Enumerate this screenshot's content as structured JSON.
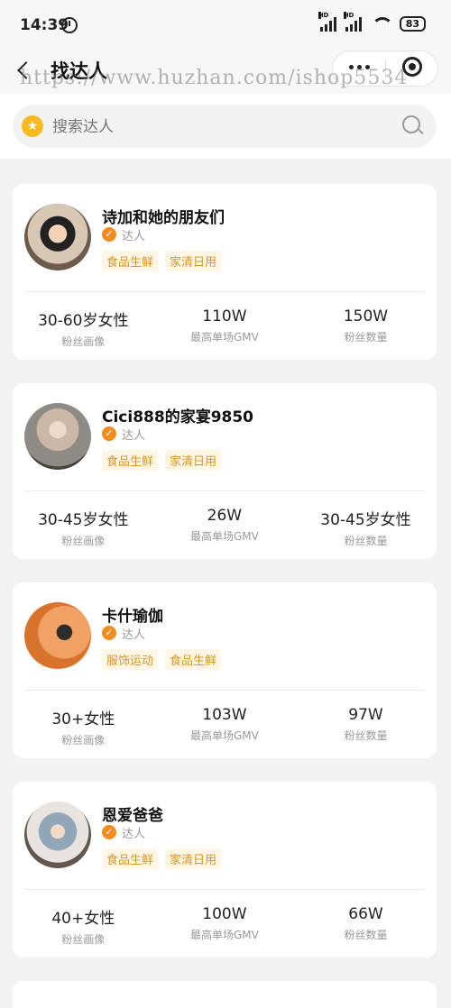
{
  "status": {
    "time": "14:39",
    "battery": "83",
    "signal_label": "HD"
  },
  "nav": {
    "title": "找达人"
  },
  "watermark": "https://www.huzhan.com/ishop5534",
  "search": {
    "placeholder": "搜索达人"
  },
  "influencers": [
    {
      "name": "诗加和她的朋友们",
      "role": "达人",
      "tags": [
        "食品生鲜",
        "家清日用"
      ],
      "stats": [
        {
          "value": "30-60岁女性",
          "label": "粉丝画像"
        },
        {
          "value": "110W",
          "label": "最高单场GMV"
        },
        {
          "value": "150W",
          "label": "粉丝数量"
        }
      ]
    },
    {
      "name": "Cici888的家宴9850",
      "role": "达人",
      "tags": [
        "食品生鲜",
        "家清日用"
      ],
      "stats": [
        {
          "value": "30-45岁女性",
          "label": "粉丝画像"
        },
        {
          "value": "26W",
          "label": "最高单场GMV"
        },
        {
          "value": "30-45岁女性",
          "label": "粉丝数量"
        }
      ]
    },
    {
      "name": "卡什瑜伽",
      "role": "达人",
      "tags": [
        "服饰运动",
        "食品生鲜"
      ],
      "stats": [
        {
          "value": "30+女性",
          "label": "粉丝画像"
        },
        {
          "value": "103W",
          "label": "最高单场GMV"
        },
        {
          "value": "97W",
          "label": "粉丝数量"
        }
      ]
    },
    {
      "name": "恩爱爸爸",
      "role": "达人",
      "tags": [
        "食品生鲜",
        "家清日用"
      ],
      "stats": [
        {
          "value": "40+女性",
          "label": "粉丝画像"
        },
        {
          "value": "100W",
          "label": "最高单场GMV"
        },
        {
          "value": "66W",
          "label": "粉丝数量"
        }
      ]
    }
  ],
  "colors": {
    "accent": "#f5b920",
    "verified": "#f28c1e",
    "tag_text": "#d4962a",
    "tag_bg": "#fff6e6"
  }
}
